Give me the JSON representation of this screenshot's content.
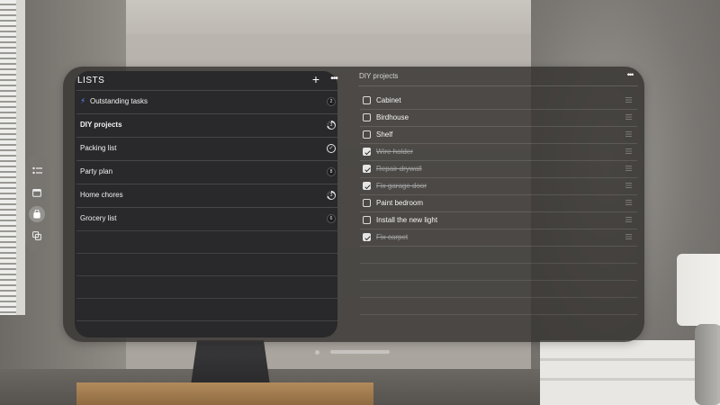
{
  "sidebar": {
    "title": "LISTS",
    "add_icon": "+",
    "more_icon": "•••",
    "items": [
      {
        "label": "Outstanding tasks",
        "badge": "2",
        "badge_type": "count",
        "icon": "bolt-icon"
      },
      {
        "label": "DIY projects",
        "badge": "3",
        "badge_type": "progress",
        "selected": true
      },
      {
        "label": "Packing list",
        "badge": "✓",
        "badge_type": "check"
      },
      {
        "label": "Party plan",
        "badge": "8",
        "badge_type": "count"
      },
      {
        "label": "Home chores",
        "badge": "3",
        "badge_type": "progress"
      },
      {
        "label": "Grocery list",
        "badge": "6",
        "badge_type": "count"
      }
    ]
  },
  "detail": {
    "title": "DIY projects",
    "more_icon": "•••",
    "tasks": [
      {
        "label": "Cabinet",
        "done": false
      },
      {
        "label": "Birdhouse",
        "done": false
      },
      {
        "label": "Shelf",
        "done": false
      },
      {
        "label": "Wire holder",
        "done": true
      },
      {
        "label": "Repair drywall",
        "done": true
      },
      {
        "label": "Fix garage door",
        "done": true
      },
      {
        "label": "Paint bedroom",
        "done": false
      },
      {
        "label": "Install the new light",
        "done": false
      },
      {
        "label": "Fix carpet",
        "done": true
      }
    ]
  },
  "ornament": {
    "buttons": [
      "checklist-icon",
      "calendar-icon",
      "bag-icon",
      "stack-icon"
    ],
    "active_index": 2
  },
  "colors": {
    "accent_bolt": "#5b8cff",
    "glass": "#343230",
    "sidebar": "#29282a"
  }
}
